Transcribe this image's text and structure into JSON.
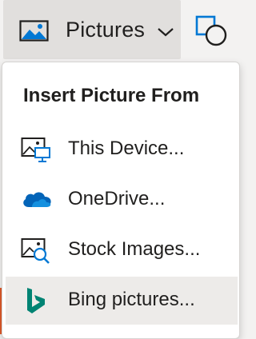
{
  "toolbar": {
    "pictures_label": "Pictures"
  },
  "menu": {
    "header": "Insert Picture From",
    "items": [
      {
        "label": "This Device...",
        "icon": "this-device-icon"
      },
      {
        "label": "OneDrive...",
        "icon": "onedrive-icon"
      },
      {
        "label": "Stock Images...",
        "icon": "stock-images-icon"
      },
      {
        "label": "Bing pictures...",
        "icon": "bing-icon"
      }
    ],
    "hovered_item": "Bing pictures..."
  },
  "colors": {
    "onedrive_blue": "#0364b8",
    "bing_teal": "#008373",
    "icon_blue": "#0078d4",
    "hover_bg": "#edebe9"
  }
}
